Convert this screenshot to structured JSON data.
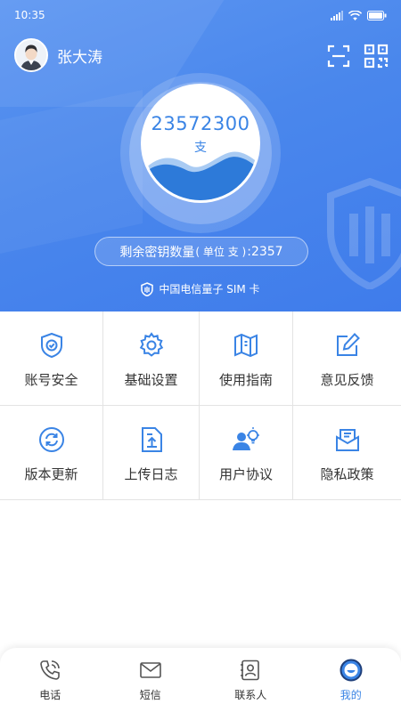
{
  "status_bar": {
    "time": "10:35"
  },
  "profile": {
    "username": "张大涛"
  },
  "keys": {
    "total": "23572300",
    "unit": "支",
    "remaining_label": "剩余密钥数量",
    "remaining_unit": "( 单位 支 )",
    "remaining_colon": ":",
    "remaining_value": "2357"
  },
  "sim_label": "中国电信量子 SIM 卡",
  "menu": {
    "items": [
      {
        "label": "账号安全",
        "icon": "shield-check-icon"
      },
      {
        "label": "基础设置",
        "icon": "gear-icon"
      },
      {
        "label": "使用指南",
        "icon": "map-icon"
      },
      {
        "label": "意见反馈",
        "icon": "edit-icon"
      },
      {
        "label": "版本更新",
        "icon": "refresh-icon"
      },
      {
        "label": "上传日志",
        "icon": "upload-file-icon"
      },
      {
        "label": "用户协议",
        "icon": "user-bulb-icon"
      },
      {
        "label": "隐私政策",
        "icon": "mail-icon"
      }
    ]
  },
  "bottom_nav": {
    "items": [
      {
        "label": "电话",
        "icon": "phone-icon"
      },
      {
        "label": "短信",
        "icon": "message-icon"
      },
      {
        "label": "联系人",
        "icon": "contacts-icon"
      },
      {
        "label": "我的",
        "icon": "profile-icon",
        "active": true
      }
    ]
  },
  "colors": {
    "primary": "#3a84e5",
    "header_top": "#5b95f1",
    "header_bottom": "#3f7ceb",
    "wave": "#2d7ad9"
  }
}
